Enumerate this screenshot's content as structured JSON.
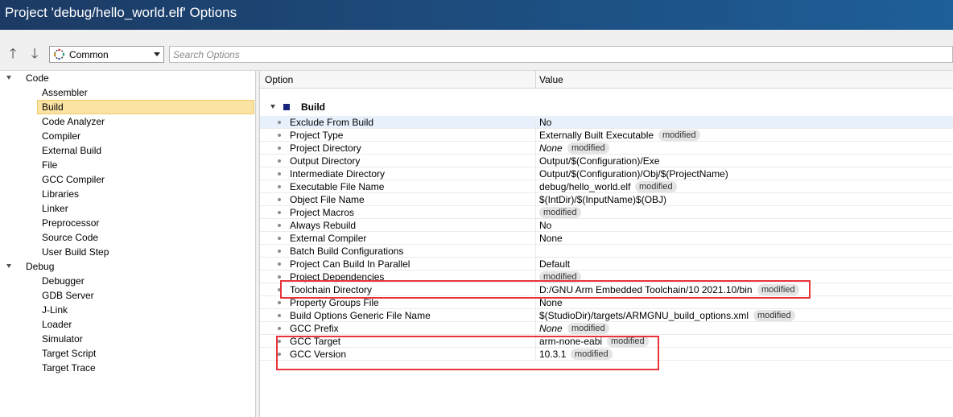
{
  "window": {
    "title": "Project 'debug/hello_world.elf' Options"
  },
  "toolbar": {
    "up_glyph": "🡑",
    "down_glyph": "🡓",
    "combo_value": "Common",
    "combo_icon": "options-icon",
    "search_placeholder": "Search Options"
  },
  "tree": {
    "code": {
      "label": "Code",
      "items": [
        "Assembler",
        "Build",
        "Code Analyzer",
        "Compiler",
        "External Build",
        "File",
        "GCC Compiler",
        "Libraries",
        "Linker",
        "Preprocessor",
        "Source Code",
        "User Build Step"
      ]
    },
    "debug": {
      "label": "Debug",
      "items": [
        "Debugger",
        "GDB Server",
        "J-Link",
        "Loader",
        "Simulator",
        "Target Script",
        "Target Trace"
      ]
    },
    "selected": "Build"
  },
  "grid": {
    "headers": {
      "option": "Option",
      "value": "Value"
    },
    "section": "Build",
    "badge_text": "modified",
    "rows": [
      {
        "name": "Exclude From Build",
        "value": "No",
        "modified": false,
        "italic": false
      },
      {
        "name": "Project Type",
        "value": "Externally Built Executable",
        "modified": true,
        "italic": false
      },
      {
        "name": "Project Directory",
        "value": "None",
        "modified": true,
        "italic": true
      },
      {
        "name": "Output Directory",
        "value": "Output/$(Configuration)/Exe",
        "modified": false,
        "italic": false
      },
      {
        "name": "Intermediate Directory",
        "value": "Output/$(Configuration)/Obj/$(ProjectName)",
        "modified": false,
        "italic": false
      },
      {
        "name": "Executable File Name",
        "value": "debug/hello_world.elf",
        "modified": true,
        "italic": false
      },
      {
        "name": "Object File Name",
        "value": "$(IntDir)/$(InputName)$(OBJ)",
        "modified": false,
        "italic": false
      },
      {
        "name": "Project Macros",
        "value": "",
        "modified": true,
        "italic": false
      },
      {
        "name": "Always Rebuild",
        "value": "No",
        "modified": false,
        "italic": false
      },
      {
        "name": "External Compiler",
        "value": "None",
        "modified": false,
        "italic": false
      },
      {
        "name": "Batch Build Configurations",
        "value": "",
        "modified": false,
        "italic": false
      },
      {
        "name": "Project Can Build In Parallel",
        "value": "Default",
        "modified": false,
        "italic": false
      },
      {
        "name": "Project Dependencies",
        "value": "",
        "modified": true,
        "italic": false
      },
      {
        "name": "Toolchain Directory",
        "value": "D:/GNU Arm Embedded Toolchain/10 2021.10/bin",
        "modified": true,
        "italic": false
      },
      {
        "name": "Property Groups File",
        "value": "None",
        "modified": false,
        "italic": false
      },
      {
        "name": "Build Options Generic File Name",
        "value": "$(StudioDir)/targets/ARMGNU_build_options.xml",
        "modified": true,
        "italic": false
      },
      {
        "name": "GCC Prefix",
        "value": "None",
        "modified": true,
        "italic": true
      },
      {
        "name": "GCC Target",
        "value": "arm-none-eabi",
        "modified": true,
        "italic": false
      },
      {
        "name": "GCC Version",
        "value": "10.3.1",
        "modified": true,
        "italic": false
      }
    ]
  },
  "colors": {
    "titlebar_start": "#1c3a63",
    "titlebar_end": "#1e5f99",
    "selection": "#fbe3a4",
    "annotation": "#e8333b",
    "section_marker": "#1a237e"
  }
}
